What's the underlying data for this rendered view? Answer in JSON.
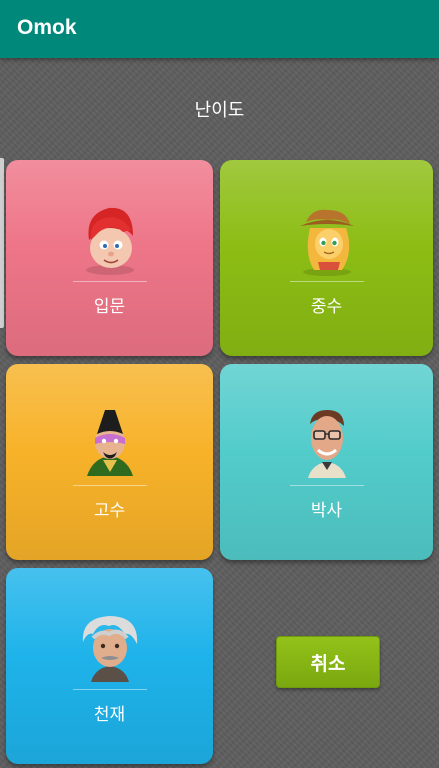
{
  "app_bar": {
    "title": "Omok"
  },
  "dialog": {
    "title": "난이도"
  },
  "levels": [
    {
      "label": "입문",
      "color": "#ee7588",
      "icon": "red-haired-boy-avatar-icon"
    },
    {
      "label": "중수",
      "color": "#8cbd14",
      "icon": "cowgirl-pony-avatar-icon"
    },
    {
      "label": "고수",
      "color": "#f7b229",
      "icon": "masked-ninja-avatar-icon"
    },
    {
      "label": "박사",
      "color": "#52cccb",
      "icon": "glasses-professor-avatar-icon"
    },
    {
      "label": "천재",
      "color": "#1eb3ea",
      "icon": "einstein-genius-avatar-icon"
    }
  ],
  "cancel_button": {
    "label": "취소",
    "color": "#8cbd14"
  },
  "colors": {
    "app_bar": "#00897b",
    "background": "#5e5e5e"
  }
}
